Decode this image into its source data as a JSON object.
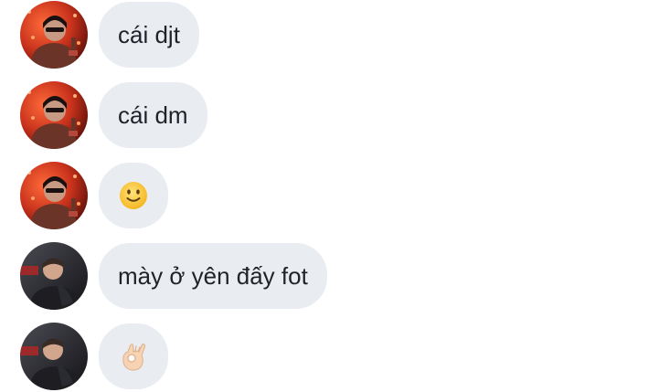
{
  "chat": {
    "messages": [
      {
        "text": "cái djt",
        "avatar": "red-avatar-icon"
      },
      {
        "text": "cái dm",
        "avatar": "red-avatar-icon"
      },
      {
        "emoji": "slightly-smiling-face-icon",
        "avatar": "red-avatar-icon"
      },
      {
        "text": "mày ở yên đấy fot",
        "avatar": "dark-avatar-icon"
      },
      {
        "emoji": "ok-hand-icon",
        "avatar": "dark-avatar-icon"
      }
    ]
  },
  "colors": {
    "bubble": "#e9edf1",
    "text": "#1f2328",
    "avatar_red": "#c8321c",
    "avatar_dark": "#2a2b30"
  }
}
